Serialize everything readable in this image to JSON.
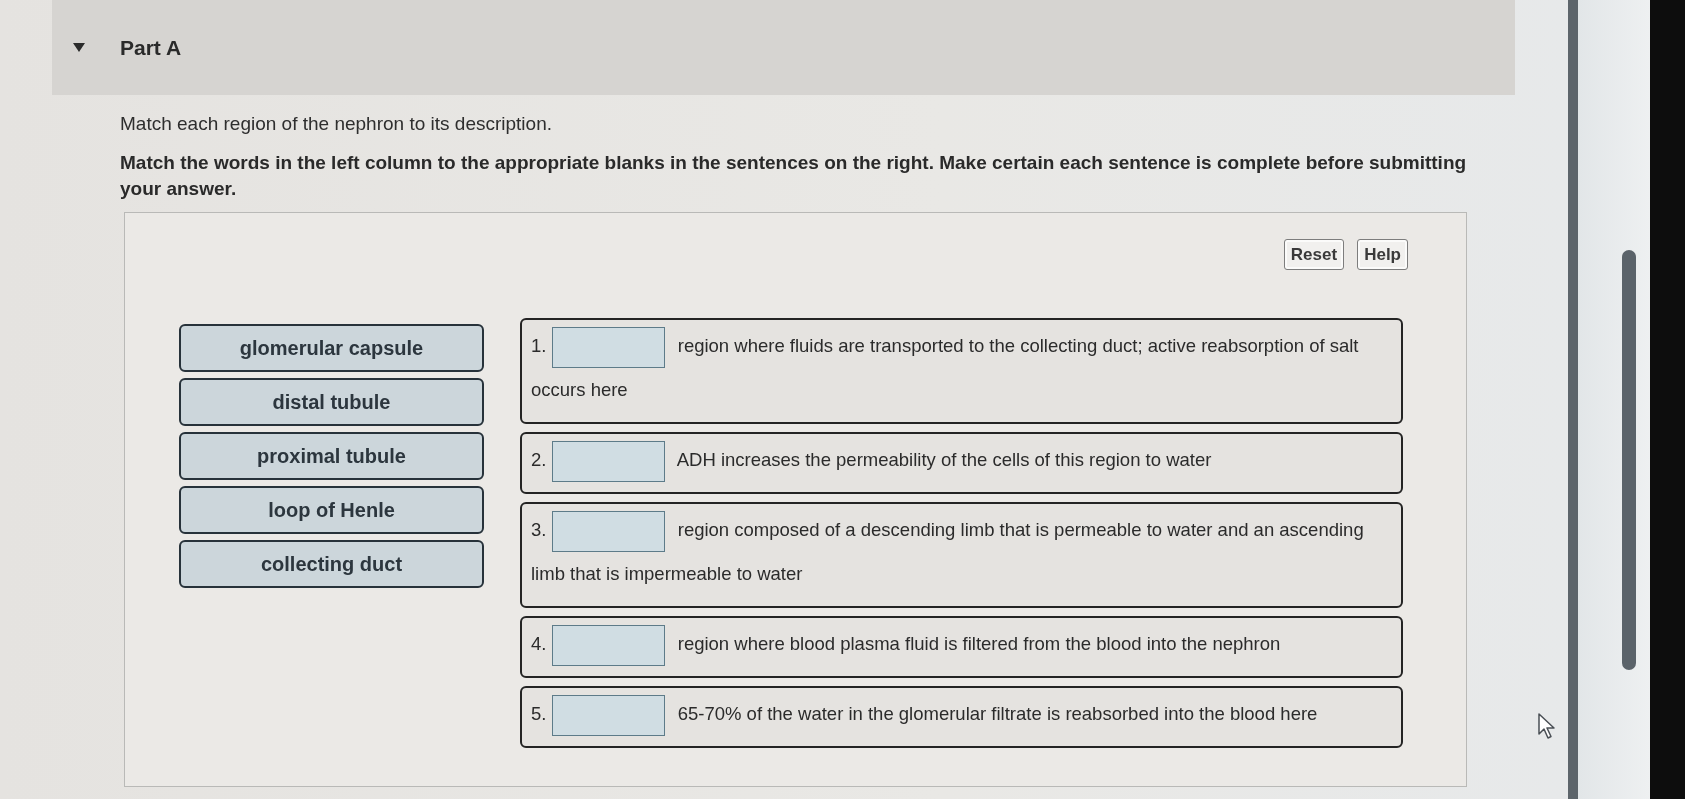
{
  "section": {
    "title": "Part A",
    "expanded": true
  },
  "intro": "Match each region of the nephron to its description.",
  "instructions": "Match the words in the left column to the appropriate blanks in the sentences on the right. Make certain each sentence is complete before submitting your answer.",
  "buttons": [
    "Reset",
    "Help"
  ],
  "word_bank": [
    "glomerular capsule",
    "distal tubule",
    "proximal tubule",
    "loop of Henle",
    "collecting duct"
  ],
  "sentences": [
    {
      "number": "1.",
      "text": "region where fluids are transported to the collecting duct; active reabsorption of salt occurs here"
    },
    {
      "number": "2.",
      "text": "ADH increases the permeability of the cells of this region to water"
    },
    {
      "number": "3.",
      "text": "region composed of a descending limb that is permeable to water and an ascending limb that is impermeable to water"
    },
    {
      "number": "4.",
      "text": "region where blood plasma fluid is filtered from the blood into the nephron"
    },
    {
      "number": "5.",
      "text": "65-70% of the water in the glomerular filtrate is reabsorbed into the blood here"
    }
  ]
}
